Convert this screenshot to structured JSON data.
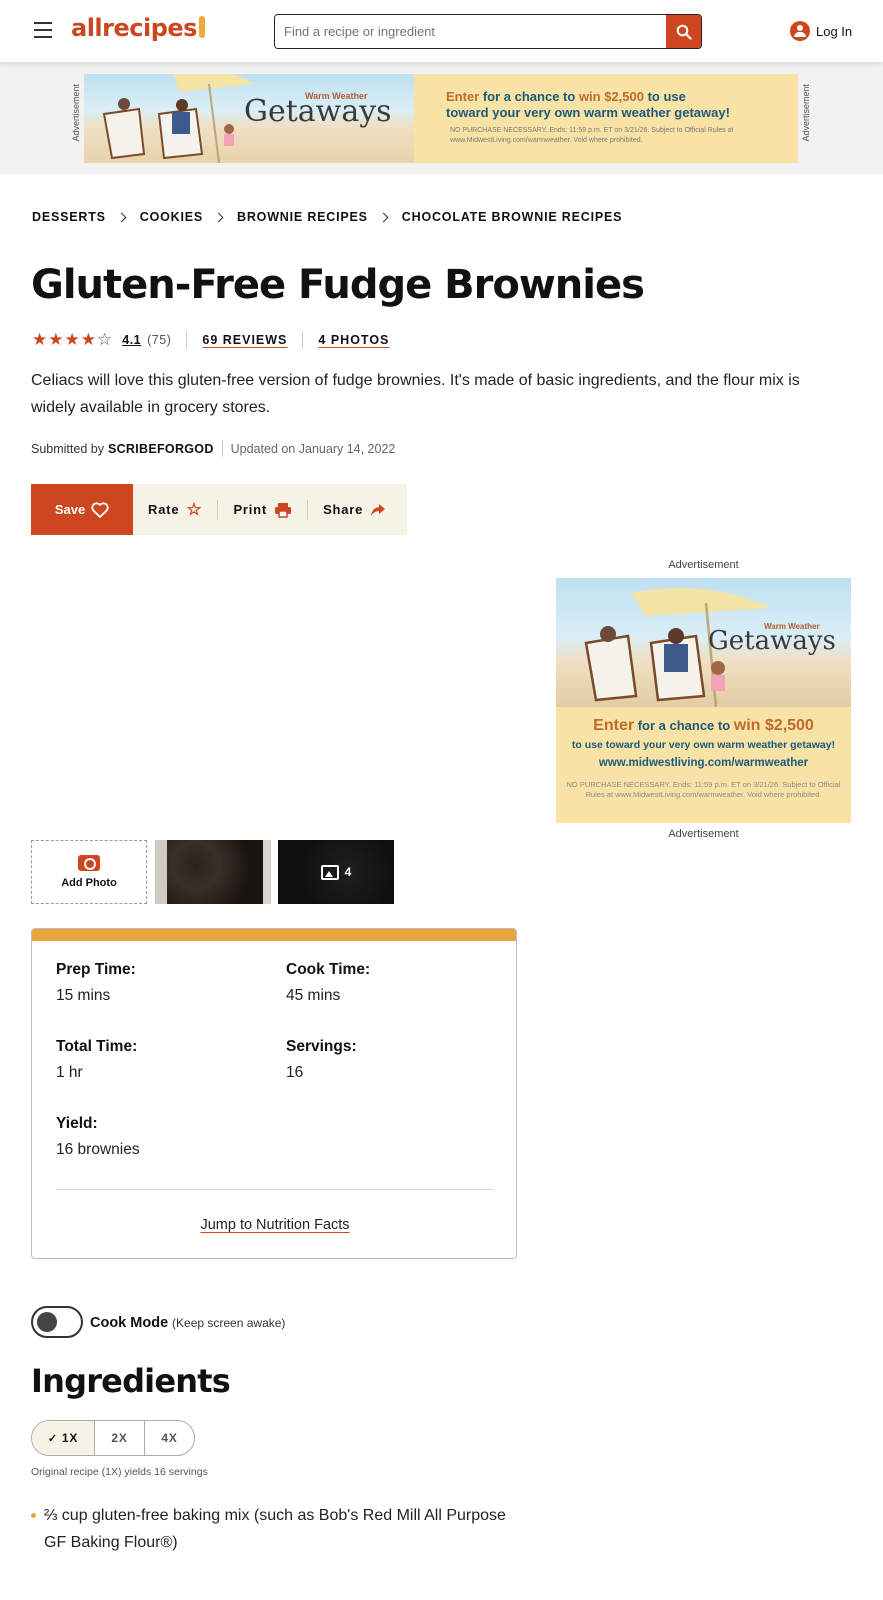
{
  "header": {
    "logo_text": "allrecipes",
    "search_placeholder": "Find a recipe or ingredient",
    "login_label": "Log In",
    "brand_color": "#ce4620"
  },
  "ads": {
    "label": "Advertisement",
    "top_banner": {
      "small_title": "Warm Weather",
      "big_title": "Getaways",
      "enter_line1_a": "Enter",
      "enter_line1_b": " for a chance to ",
      "enter_line1_c": "win $2,500",
      "enter_line1_d": " to use",
      "enter_line2": "toward your very own warm weather getaway!",
      "fine_print": "NO PURCHASE NECESSARY. Ends: 11:59 p.m. ET on 3/21/26. Subject to Official Rules at www.MidwestLiving.com/warmweather. Void where prohibited."
    },
    "side": {
      "small_title": "Warm Weather",
      "big_title": "Getaways",
      "enter_a": "Enter",
      "enter_b": " for a chance to ",
      "enter_c": "win $2,500",
      "sub": "to use toward your very own warm weather getaway!",
      "url": "www.midwestliving.com/warmweather",
      "fine_print": "NO PURCHASE NECESSARY. Ends: 11:59 p.m. ET on 3/21/26. Subject to Official Rules at www.MidwestLiving.com/warmweather. Void where prohibited."
    }
  },
  "breadcrumb": [
    "DESSERTS",
    "COOKIES",
    "BROWNIE RECIPES",
    "CHOCOLATE BROWNIE RECIPES"
  ],
  "recipe": {
    "title": "Gluten-Free Fudge Brownies",
    "rating": 4.1,
    "rating_text": "4.1",
    "rating_count": "(75)",
    "reviews_link": "69 REVIEWS",
    "photos_link": "4 PHOTOS",
    "description": "Celiacs will love this gluten-free version of fudge brownies. It's made of basic ingredients, and the flour mix is widely available in grocery stores.",
    "submitted_prefix": "Submitted by",
    "author": "SCRIBEFORGOD",
    "updated": "Updated on January 14, 2022"
  },
  "actions": {
    "save": "Save",
    "rate": "Rate",
    "print": "Print",
    "share": "Share"
  },
  "photos": {
    "add_label": "Add Photo",
    "count": "4"
  },
  "details": {
    "prep_label": "Prep Time:",
    "prep_value": "15 mins",
    "cook_label": "Cook Time:",
    "cook_value": "45 mins",
    "total_label": "Total Time:",
    "total_value": "1 hr",
    "servings_label": "Servings:",
    "servings_value": "16",
    "yield_label": "Yield:",
    "yield_value": "16 brownies",
    "jump_link": "Jump to Nutrition Facts"
  },
  "cook_mode": {
    "label": "Cook Mode",
    "hint": "(Keep screen awake)",
    "enabled": false
  },
  "ingredients": {
    "heading": "Ingredients",
    "scale_options": [
      "1X",
      "2X",
      "4X"
    ],
    "selected_scale": "1X",
    "yield_note": "Original recipe (1X) yields 16 servings",
    "items": [
      "⅔ cup gluten-free baking mix (such as Bob's Red Mill All Purpose GF Baking Flour®)"
    ]
  }
}
